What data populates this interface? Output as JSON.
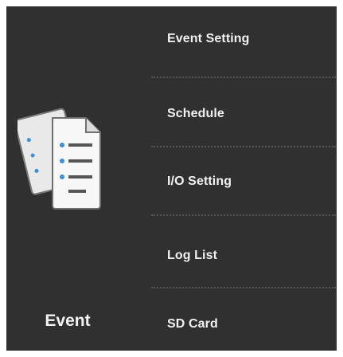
{
  "module": {
    "label": "Event",
    "icon": "documents-icon"
  },
  "menu": {
    "items": [
      {
        "id": "event-setting",
        "label": "Event Setting"
      },
      {
        "id": "schedule",
        "label": "Schedule"
      },
      {
        "id": "io-setting",
        "label": "I/O Setting"
      },
      {
        "id": "log-list",
        "label": "Log List"
      },
      {
        "id": "sd-card",
        "label": "SD Card"
      }
    ]
  },
  "colors": {
    "panel_background": "#303030",
    "text": "#f2f2f2",
    "divider": "#555555",
    "icon_bullet": "#3a8fd8"
  }
}
